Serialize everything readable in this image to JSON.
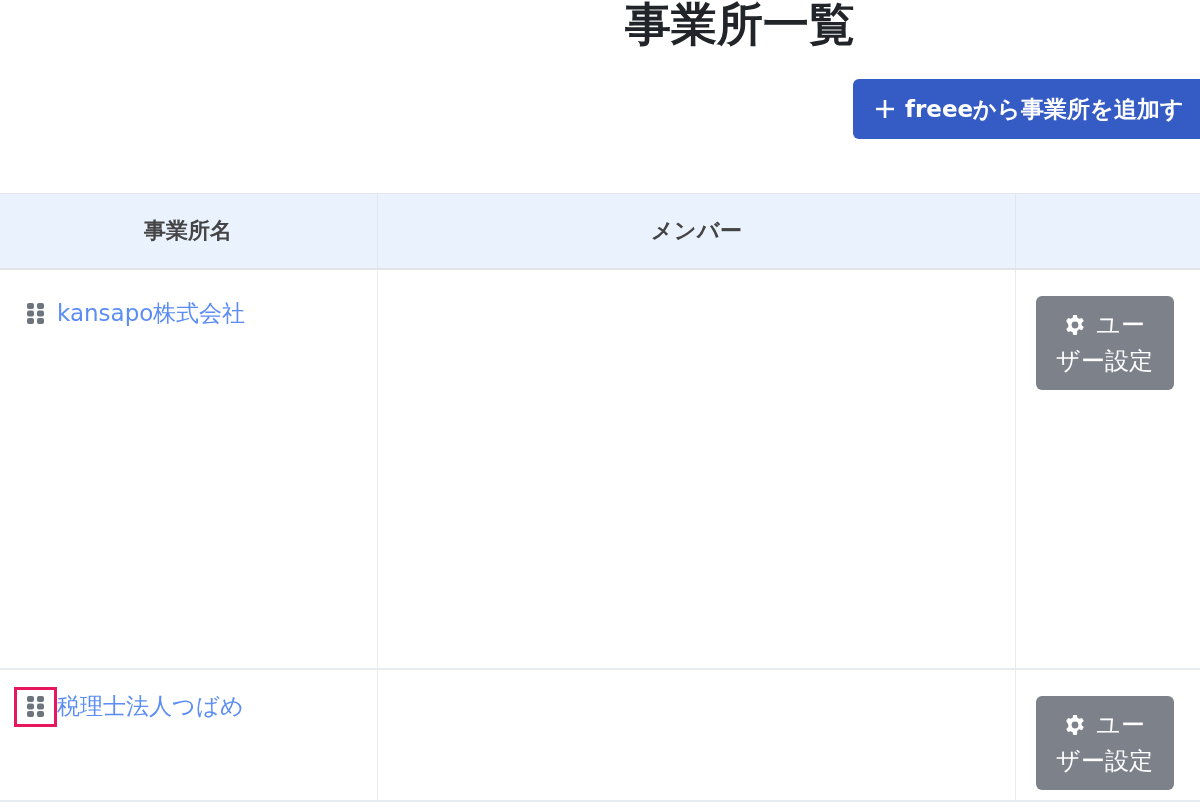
{
  "page": {
    "title": "事業所一覧"
  },
  "add_button": {
    "label": "freeeから事業所を追加す"
  },
  "table": {
    "columns": [
      "事業所名",
      "メンバー"
    ],
    "rows": [
      {
        "office": "kansapo株式会社",
        "action": "ユーザー設定",
        "highlighted": false
      },
      {
        "office": "税理士法人つばめ",
        "action": "ユーザー設定",
        "highlighted": true
      }
    ]
  }
}
